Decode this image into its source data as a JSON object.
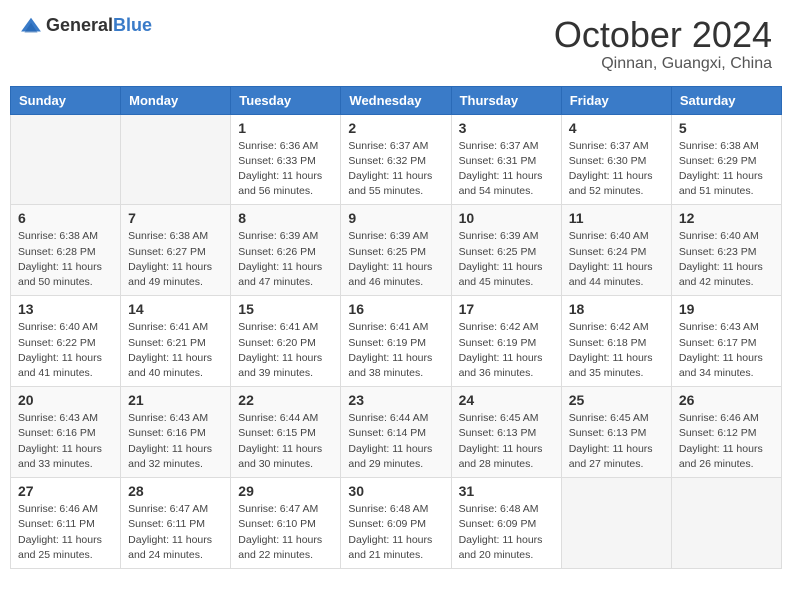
{
  "header": {
    "logo_general": "General",
    "logo_blue": "Blue",
    "month": "October 2024",
    "location": "Qinnan, Guangxi, China"
  },
  "days_of_week": [
    "Sunday",
    "Monday",
    "Tuesday",
    "Wednesday",
    "Thursday",
    "Friday",
    "Saturday"
  ],
  "weeks": [
    [
      {
        "day": "",
        "sunrise": "",
        "sunset": "",
        "daylight": ""
      },
      {
        "day": "",
        "sunrise": "",
        "sunset": "",
        "daylight": ""
      },
      {
        "day": "1",
        "sunrise": "Sunrise: 6:36 AM",
        "sunset": "Sunset: 6:33 PM",
        "daylight": "Daylight: 11 hours and 56 minutes."
      },
      {
        "day": "2",
        "sunrise": "Sunrise: 6:37 AM",
        "sunset": "Sunset: 6:32 PM",
        "daylight": "Daylight: 11 hours and 55 minutes."
      },
      {
        "day": "3",
        "sunrise": "Sunrise: 6:37 AM",
        "sunset": "Sunset: 6:31 PM",
        "daylight": "Daylight: 11 hours and 54 minutes."
      },
      {
        "day": "4",
        "sunrise": "Sunrise: 6:37 AM",
        "sunset": "Sunset: 6:30 PM",
        "daylight": "Daylight: 11 hours and 52 minutes."
      },
      {
        "day": "5",
        "sunrise": "Sunrise: 6:38 AM",
        "sunset": "Sunset: 6:29 PM",
        "daylight": "Daylight: 11 hours and 51 minutes."
      }
    ],
    [
      {
        "day": "6",
        "sunrise": "Sunrise: 6:38 AM",
        "sunset": "Sunset: 6:28 PM",
        "daylight": "Daylight: 11 hours and 50 minutes."
      },
      {
        "day": "7",
        "sunrise": "Sunrise: 6:38 AM",
        "sunset": "Sunset: 6:27 PM",
        "daylight": "Daylight: 11 hours and 49 minutes."
      },
      {
        "day": "8",
        "sunrise": "Sunrise: 6:39 AM",
        "sunset": "Sunset: 6:26 PM",
        "daylight": "Daylight: 11 hours and 47 minutes."
      },
      {
        "day": "9",
        "sunrise": "Sunrise: 6:39 AM",
        "sunset": "Sunset: 6:25 PM",
        "daylight": "Daylight: 11 hours and 46 minutes."
      },
      {
        "day": "10",
        "sunrise": "Sunrise: 6:39 AM",
        "sunset": "Sunset: 6:25 PM",
        "daylight": "Daylight: 11 hours and 45 minutes."
      },
      {
        "day": "11",
        "sunrise": "Sunrise: 6:40 AM",
        "sunset": "Sunset: 6:24 PM",
        "daylight": "Daylight: 11 hours and 44 minutes."
      },
      {
        "day": "12",
        "sunrise": "Sunrise: 6:40 AM",
        "sunset": "Sunset: 6:23 PM",
        "daylight": "Daylight: 11 hours and 42 minutes."
      }
    ],
    [
      {
        "day": "13",
        "sunrise": "Sunrise: 6:40 AM",
        "sunset": "Sunset: 6:22 PM",
        "daylight": "Daylight: 11 hours and 41 minutes."
      },
      {
        "day": "14",
        "sunrise": "Sunrise: 6:41 AM",
        "sunset": "Sunset: 6:21 PM",
        "daylight": "Daylight: 11 hours and 40 minutes."
      },
      {
        "day": "15",
        "sunrise": "Sunrise: 6:41 AM",
        "sunset": "Sunset: 6:20 PM",
        "daylight": "Daylight: 11 hours and 39 minutes."
      },
      {
        "day": "16",
        "sunrise": "Sunrise: 6:41 AM",
        "sunset": "Sunset: 6:19 PM",
        "daylight": "Daylight: 11 hours and 38 minutes."
      },
      {
        "day": "17",
        "sunrise": "Sunrise: 6:42 AM",
        "sunset": "Sunset: 6:19 PM",
        "daylight": "Daylight: 11 hours and 36 minutes."
      },
      {
        "day": "18",
        "sunrise": "Sunrise: 6:42 AM",
        "sunset": "Sunset: 6:18 PM",
        "daylight": "Daylight: 11 hours and 35 minutes."
      },
      {
        "day": "19",
        "sunrise": "Sunrise: 6:43 AM",
        "sunset": "Sunset: 6:17 PM",
        "daylight": "Daylight: 11 hours and 34 minutes."
      }
    ],
    [
      {
        "day": "20",
        "sunrise": "Sunrise: 6:43 AM",
        "sunset": "Sunset: 6:16 PM",
        "daylight": "Daylight: 11 hours and 33 minutes."
      },
      {
        "day": "21",
        "sunrise": "Sunrise: 6:43 AM",
        "sunset": "Sunset: 6:16 PM",
        "daylight": "Daylight: 11 hours and 32 minutes."
      },
      {
        "day": "22",
        "sunrise": "Sunrise: 6:44 AM",
        "sunset": "Sunset: 6:15 PM",
        "daylight": "Daylight: 11 hours and 30 minutes."
      },
      {
        "day": "23",
        "sunrise": "Sunrise: 6:44 AM",
        "sunset": "Sunset: 6:14 PM",
        "daylight": "Daylight: 11 hours and 29 minutes."
      },
      {
        "day": "24",
        "sunrise": "Sunrise: 6:45 AM",
        "sunset": "Sunset: 6:13 PM",
        "daylight": "Daylight: 11 hours and 28 minutes."
      },
      {
        "day": "25",
        "sunrise": "Sunrise: 6:45 AM",
        "sunset": "Sunset: 6:13 PM",
        "daylight": "Daylight: 11 hours and 27 minutes."
      },
      {
        "day": "26",
        "sunrise": "Sunrise: 6:46 AM",
        "sunset": "Sunset: 6:12 PM",
        "daylight": "Daylight: 11 hours and 26 minutes."
      }
    ],
    [
      {
        "day": "27",
        "sunrise": "Sunrise: 6:46 AM",
        "sunset": "Sunset: 6:11 PM",
        "daylight": "Daylight: 11 hours and 25 minutes."
      },
      {
        "day": "28",
        "sunrise": "Sunrise: 6:47 AM",
        "sunset": "Sunset: 6:11 PM",
        "daylight": "Daylight: 11 hours and 24 minutes."
      },
      {
        "day": "29",
        "sunrise": "Sunrise: 6:47 AM",
        "sunset": "Sunset: 6:10 PM",
        "daylight": "Daylight: 11 hours and 22 minutes."
      },
      {
        "day": "30",
        "sunrise": "Sunrise: 6:48 AM",
        "sunset": "Sunset: 6:09 PM",
        "daylight": "Daylight: 11 hours and 21 minutes."
      },
      {
        "day": "31",
        "sunrise": "Sunrise: 6:48 AM",
        "sunset": "Sunset: 6:09 PM",
        "daylight": "Daylight: 11 hours and 20 minutes."
      },
      {
        "day": "",
        "sunrise": "",
        "sunset": "",
        "daylight": ""
      },
      {
        "day": "",
        "sunrise": "",
        "sunset": "",
        "daylight": ""
      }
    ]
  ]
}
